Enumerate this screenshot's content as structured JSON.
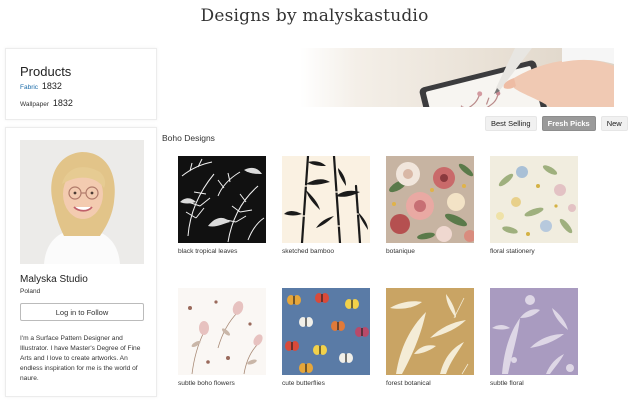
{
  "header": {
    "title": "Designs by malyskastudio"
  },
  "products": {
    "title": "Products",
    "counts": [
      {
        "label": "Fabric",
        "value": "1832"
      },
      {
        "label": "Wallpaper",
        "value": "1832"
      }
    ]
  },
  "profile": {
    "name": "Malyska Studio",
    "location": "Poland",
    "follow_label": "Log in to Follow",
    "bio": "I'm a Surface Pattern Designer and Illustrator. I have Master's Degree of Fine Arts and I love to create artworks. An endless inspiration for me is the world of naure."
  },
  "sort": {
    "options": [
      "Best Selling",
      "Fresh Picks",
      "New"
    ],
    "active": "Fresh Picks"
  },
  "collection": {
    "title": "Boho Designs"
  },
  "designs": [
    {
      "name": "black tropical leaves"
    },
    {
      "name": "sketched bamboo"
    },
    {
      "name": "botanique"
    },
    {
      "name": "floral stationery"
    },
    {
      "name": "subtle boho flowers"
    },
    {
      "name": "cute butterflies"
    },
    {
      "name": "forest botanical"
    },
    {
      "name": "subtle floral"
    }
  ],
  "colors": {
    "fabric_link": "#1a6aa8",
    "active_tab": "#9a9a9a",
    "butterfly_bg": "#5a7ba6",
    "forest_bg": "#c9a464",
    "subtle_floral_bg": "#a99bc0"
  }
}
